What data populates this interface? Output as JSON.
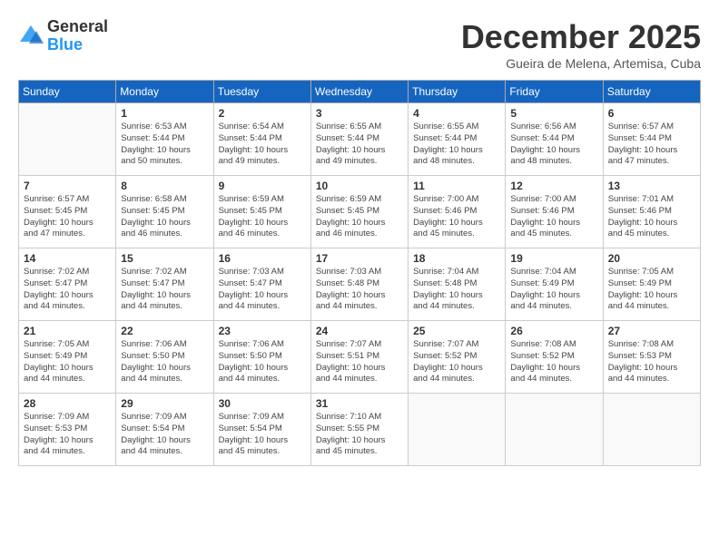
{
  "header": {
    "logo_general": "General",
    "logo_blue": "Blue",
    "month_title": "December 2025",
    "location": "Gueira de Melena, Artemisa, Cuba"
  },
  "weekdays": [
    "Sunday",
    "Monday",
    "Tuesday",
    "Wednesday",
    "Thursday",
    "Friday",
    "Saturday"
  ],
  "weeks": [
    [
      {
        "day": "",
        "info": ""
      },
      {
        "day": "1",
        "info": "Sunrise: 6:53 AM\nSunset: 5:44 PM\nDaylight: 10 hours\nand 50 minutes."
      },
      {
        "day": "2",
        "info": "Sunrise: 6:54 AM\nSunset: 5:44 PM\nDaylight: 10 hours\nand 49 minutes."
      },
      {
        "day": "3",
        "info": "Sunrise: 6:55 AM\nSunset: 5:44 PM\nDaylight: 10 hours\nand 49 minutes."
      },
      {
        "day": "4",
        "info": "Sunrise: 6:55 AM\nSunset: 5:44 PM\nDaylight: 10 hours\nand 48 minutes."
      },
      {
        "day": "5",
        "info": "Sunrise: 6:56 AM\nSunset: 5:44 PM\nDaylight: 10 hours\nand 48 minutes."
      },
      {
        "day": "6",
        "info": "Sunrise: 6:57 AM\nSunset: 5:44 PM\nDaylight: 10 hours\nand 47 minutes."
      }
    ],
    [
      {
        "day": "7",
        "info": "Sunrise: 6:57 AM\nSunset: 5:45 PM\nDaylight: 10 hours\nand 47 minutes."
      },
      {
        "day": "8",
        "info": "Sunrise: 6:58 AM\nSunset: 5:45 PM\nDaylight: 10 hours\nand 46 minutes."
      },
      {
        "day": "9",
        "info": "Sunrise: 6:59 AM\nSunset: 5:45 PM\nDaylight: 10 hours\nand 46 minutes."
      },
      {
        "day": "10",
        "info": "Sunrise: 6:59 AM\nSunset: 5:45 PM\nDaylight: 10 hours\nand 46 minutes."
      },
      {
        "day": "11",
        "info": "Sunrise: 7:00 AM\nSunset: 5:46 PM\nDaylight: 10 hours\nand 45 minutes."
      },
      {
        "day": "12",
        "info": "Sunrise: 7:00 AM\nSunset: 5:46 PM\nDaylight: 10 hours\nand 45 minutes."
      },
      {
        "day": "13",
        "info": "Sunrise: 7:01 AM\nSunset: 5:46 PM\nDaylight: 10 hours\nand 45 minutes."
      }
    ],
    [
      {
        "day": "14",
        "info": "Sunrise: 7:02 AM\nSunset: 5:47 PM\nDaylight: 10 hours\nand 44 minutes."
      },
      {
        "day": "15",
        "info": "Sunrise: 7:02 AM\nSunset: 5:47 PM\nDaylight: 10 hours\nand 44 minutes."
      },
      {
        "day": "16",
        "info": "Sunrise: 7:03 AM\nSunset: 5:47 PM\nDaylight: 10 hours\nand 44 minutes."
      },
      {
        "day": "17",
        "info": "Sunrise: 7:03 AM\nSunset: 5:48 PM\nDaylight: 10 hours\nand 44 minutes."
      },
      {
        "day": "18",
        "info": "Sunrise: 7:04 AM\nSunset: 5:48 PM\nDaylight: 10 hours\nand 44 minutes."
      },
      {
        "day": "19",
        "info": "Sunrise: 7:04 AM\nSunset: 5:49 PM\nDaylight: 10 hours\nand 44 minutes."
      },
      {
        "day": "20",
        "info": "Sunrise: 7:05 AM\nSunset: 5:49 PM\nDaylight: 10 hours\nand 44 minutes."
      }
    ],
    [
      {
        "day": "21",
        "info": "Sunrise: 7:05 AM\nSunset: 5:49 PM\nDaylight: 10 hours\nand 44 minutes."
      },
      {
        "day": "22",
        "info": "Sunrise: 7:06 AM\nSunset: 5:50 PM\nDaylight: 10 hours\nand 44 minutes."
      },
      {
        "day": "23",
        "info": "Sunrise: 7:06 AM\nSunset: 5:50 PM\nDaylight: 10 hours\nand 44 minutes."
      },
      {
        "day": "24",
        "info": "Sunrise: 7:07 AM\nSunset: 5:51 PM\nDaylight: 10 hours\nand 44 minutes."
      },
      {
        "day": "25",
        "info": "Sunrise: 7:07 AM\nSunset: 5:52 PM\nDaylight: 10 hours\nand 44 minutes."
      },
      {
        "day": "26",
        "info": "Sunrise: 7:08 AM\nSunset: 5:52 PM\nDaylight: 10 hours\nand 44 minutes."
      },
      {
        "day": "27",
        "info": "Sunrise: 7:08 AM\nSunset: 5:53 PM\nDaylight: 10 hours\nand 44 minutes."
      }
    ],
    [
      {
        "day": "28",
        "info": "Sunrise: 7:09 AM\nSunset: 5:53 PM\nDaylight: 10 hours\nand 44 minutes."
      },
      {
        "day": "29",
        "info": "Sunrise: 7:09 AM\nSunset: 5:54 PM\nDaylight: 10 hours\nand 44 minutes."
      },
      {
        "day": "30",
        "info": "Sunrise: 7:09 AM\nSunset: 5:54 PM\nDaylight: 10 hours\nand 45 minutes."
      },
      {
        "day": "31",
        "info": "Sunrise: 7:10 AM\nSunset: 5:55 PM\nDaylight: 10 hours\nand 45 minutes."
      },
      {
        "day": "",
        "info": ""
      },
      {
        "day": "",
        "info": ""
      },
      {
        "day": "",
        "info": ""
      }
    ]
  ]
}
